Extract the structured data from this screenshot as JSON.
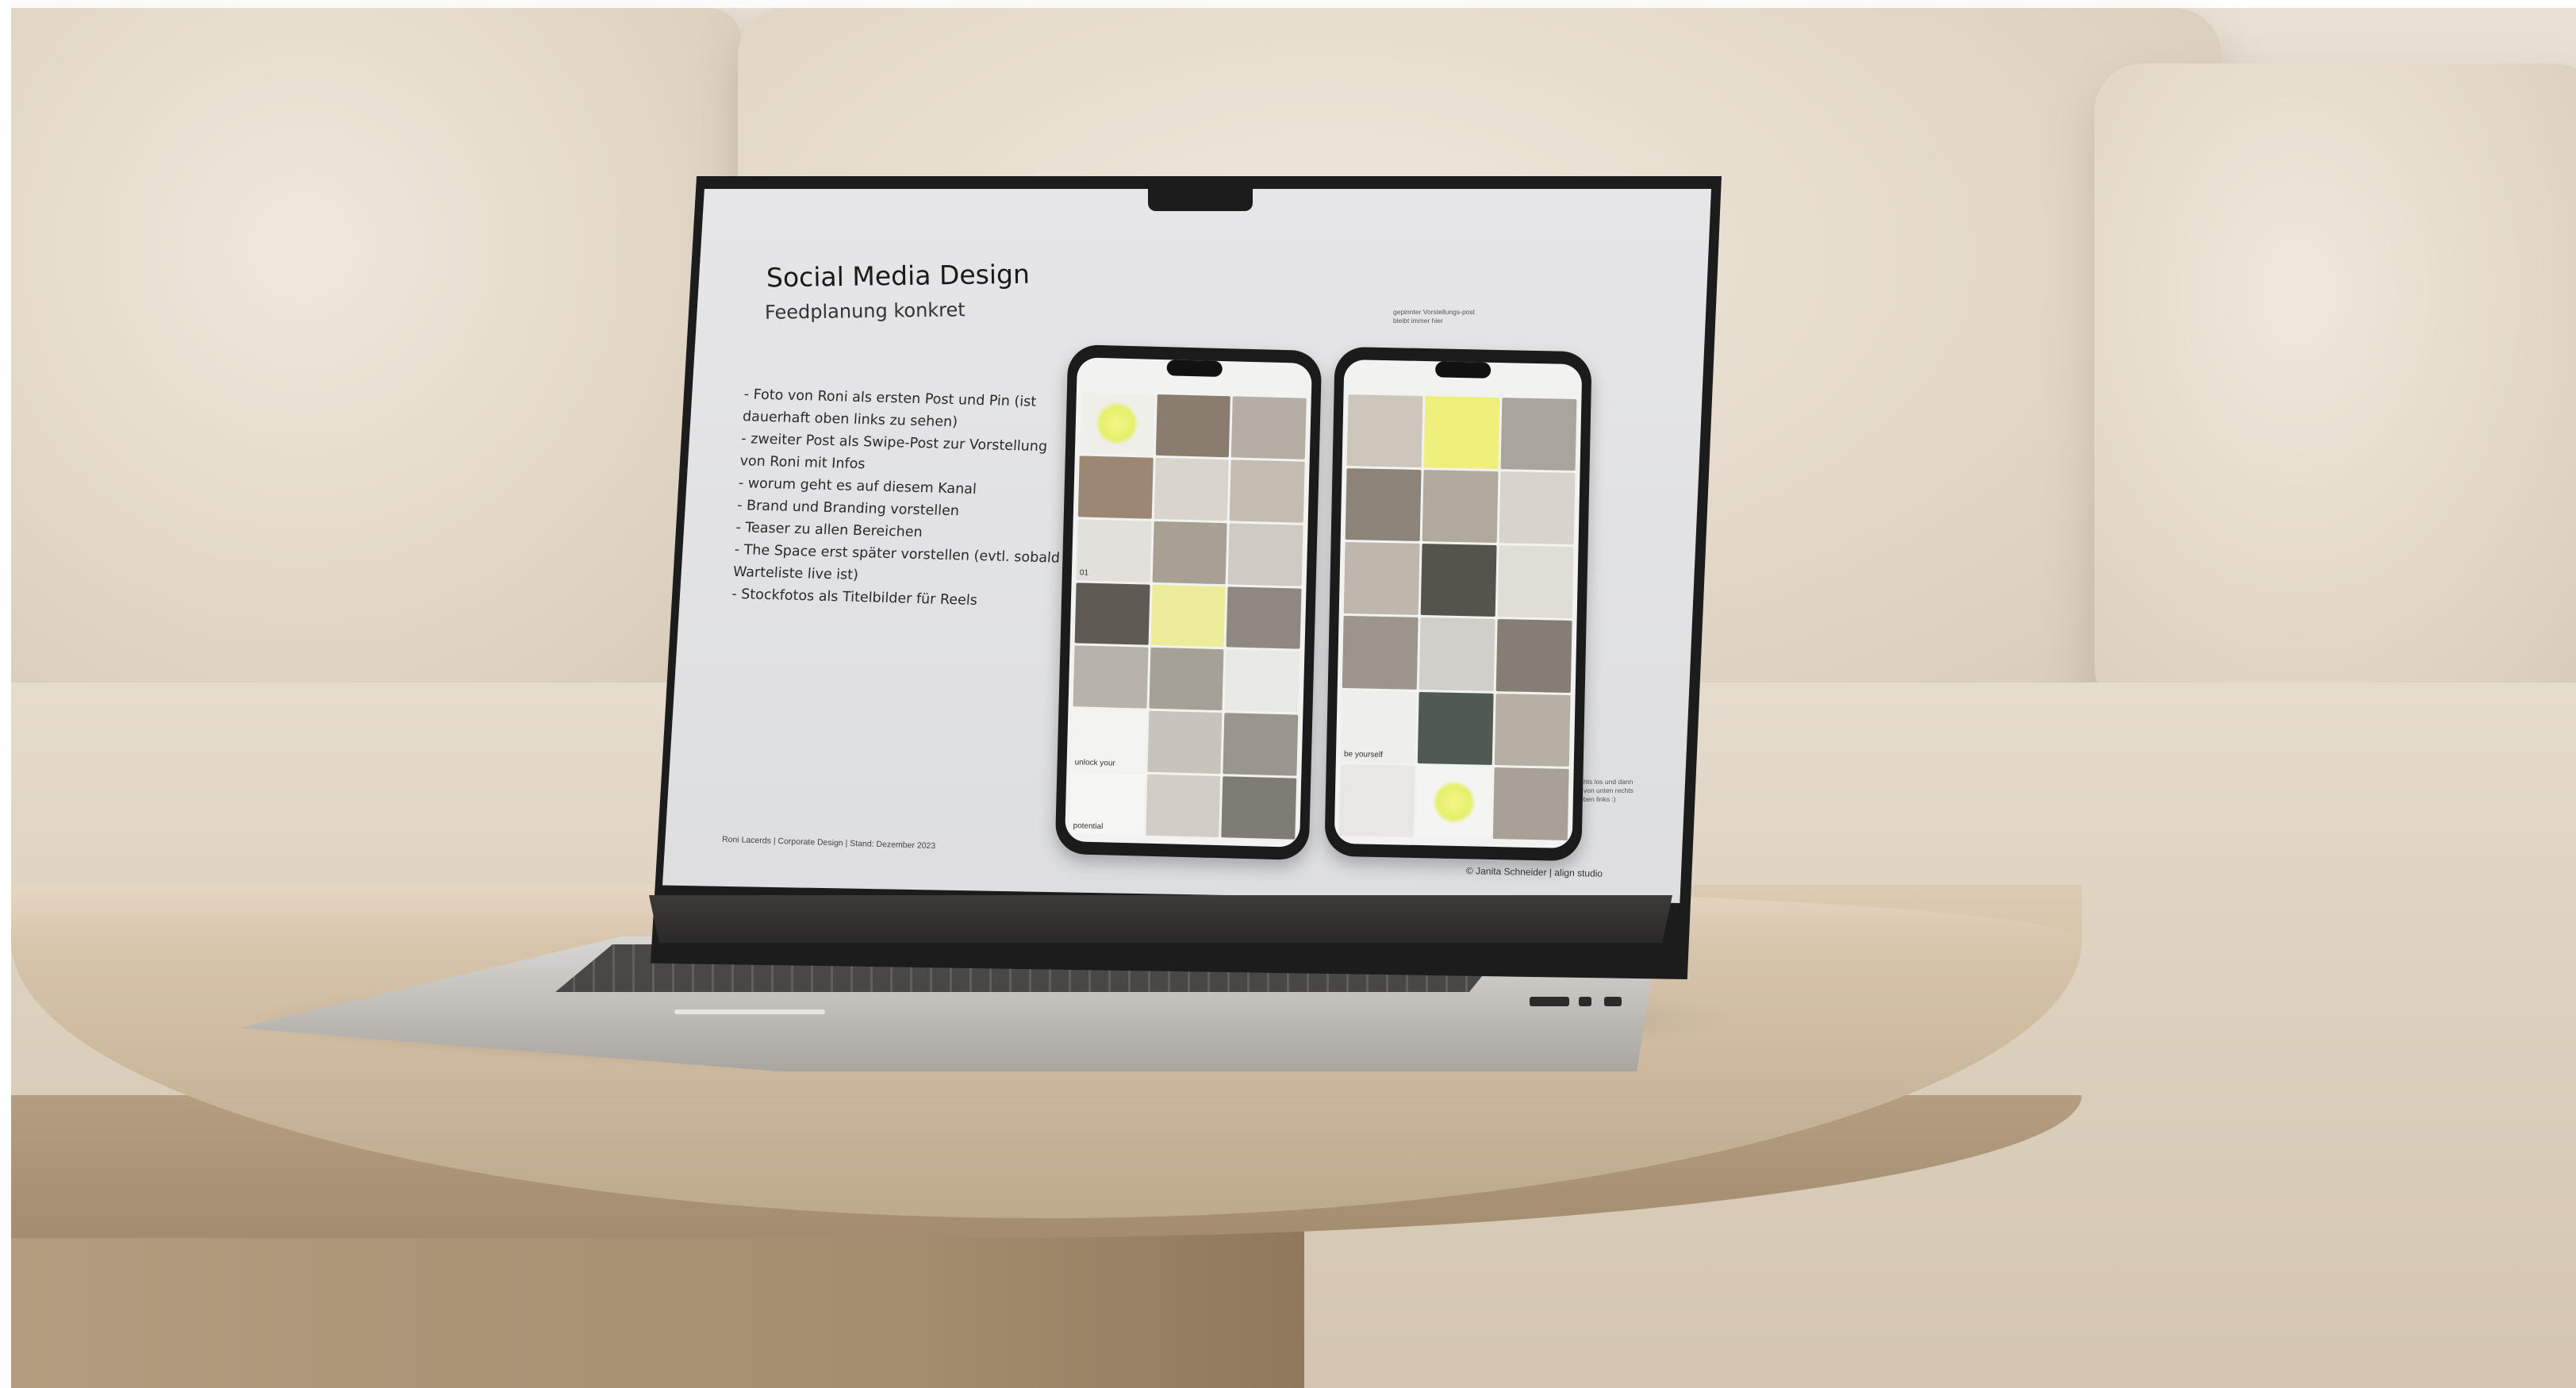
{
  "slide": {
    "title": "Social Media Design",
    "subtitle": "Feedplanung  konkret",
    "bullets": [
      "- Foto von Roni als ersten Post und Pin (ist",
      "  dauerhaft oben links zu sehen)",
      "- zweiter Post als Swipe-Post zur Vorstellung",
      "  von Roni mit Infos",
      "- worum geht es auf diesem Kanal",
      "- Brand und Branding vorstellen",
      "- Teaser zu allen Bereichen",
      "- The Space erst später vorstellen (evtl. sobald",
      "  Warteliste live ist)",
      "- Stockfotos als Titelbilder für Reels"
    ],
    "footer_left": "Roni Lacerds  |  Corporate Design  |  Stand: Dezember 2023",
    "footer_right": "© Janita Schneider | align studio",
    "note_top": "gepinnter Vorstellungs-post bleibt immer hier",
    "note_side": "hier gehts los und dann immer von unten rechts nach oben links :)"
  },
  "phone_left_tiles": [
    {
      "c": "#efefe9",
      "dot": true
    },
    {
      "c": "#8a7d70"
    },
    {
      "c": "#b6aea4"
    },
    {
      "c": "#9c8773"
    },
    {
      "c": "#d9d4cc"
    },
    {
      "c": "#c4bcb1"
    },
    {
      "c": "#e2e0da",
      "text": "01"
    },
    {
      "c": "#a9a094"
    },
    {
      "c": "#cfcbc2"
    },
    {
      "c": "#5f5a53"
    },
    {
      "c": "#ecec9a"
    },
    {
      "c": "#8f8880"
    },
    {
      "c": "#b8b3aa"
    },
    {
      "c": "#a6a196"
    },
    {
      "c": "#e9e9e6"
    },
    {
      "c": "#f3f3f1",
      "text": "unlock your"
    },
    {
      "c": "#c9c4bb"
    },
    {
      "c": "#9a968e"
    },
    {
      "c": "#f6f6f4",
      "text": "potential"
    },
    {
      "c": "#d2cec6"
    },
    {
      "c": "#7f7c76"
    }
  ],
  "phone_right_tiles": [
    {
      "c": "#cdc6bb"
    },
    {
      "c": "#eef07a"
    },
    {
      "c": "#a9a49c"
    },
    {
      "c": "#8c8379"
    },
    {
      "c": "#b1a99d"
    },
    {
      "c": "#d8d4cd"
    },
    {
      "c": "#bfb7ac"
    },
    {
      "c": "#56524c"
    },
    {
      "c": "#e0ddd7"
    },
    {
      "c": "#9b958b"
    },
    {
      "c": "#d1cfc9"
    },
    {
      "c": "#857e74"
    },
    {
      "c": "#eeeeec",
      "text": "be yourself"
    },
    {
      "c": "#4f5a52"
    },
    {
      "c": "#b6afa4"
    },
    {
      "c": "#e9e7e3"
    },
    {
      "c": "#f4f4f2",
      "dot": true
    },
    {
      "c": "#a7a197"
    }
  ]
}
